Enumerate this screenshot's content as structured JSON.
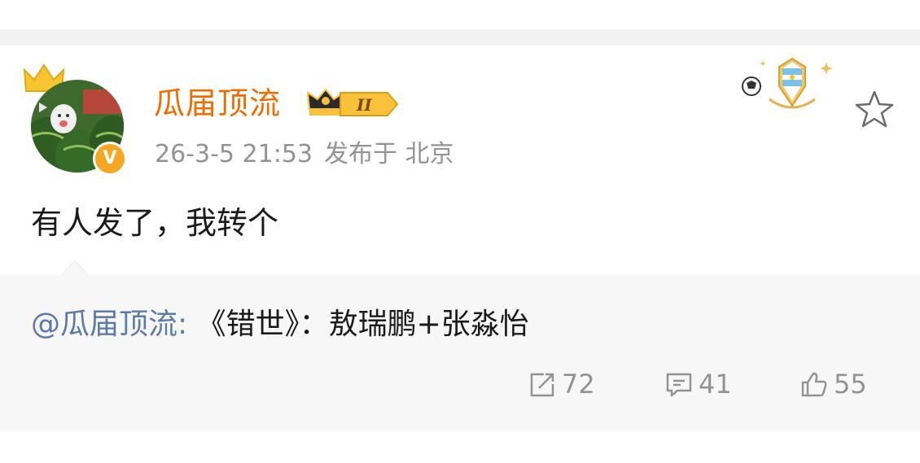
{
  "post": {
    "username": "瓜届顶流",
    "vip_level": "II",
    "timestamp": "26-3-5 21:53",
    "source": "发布于 北京",
    "content": "有人发了，我转个",
    "verified_icon": "v-verified-icon",
    "header_icons": [
      "crown-icon",
      "vip-crown-icon",
      "argentina-medal-icon",
      "star-icon"
    ]
  },
  "repost": {
    "mention": "@瓜届顶流:",
    "text": " 《错世》：敖瑞鹏+张淼怡"
  },
  "actions": {
    "repost_count": "72",
    "comment_count": "41",
    "like_count": "55"
  },
  "colors": {
    "username": "#f06c00",
    "mention": "#5b7ba6",
    "meta": "#939393",
    "divider": "#f2f2f2",
    "repost_bg": "#f7f7f7"
  }
}
